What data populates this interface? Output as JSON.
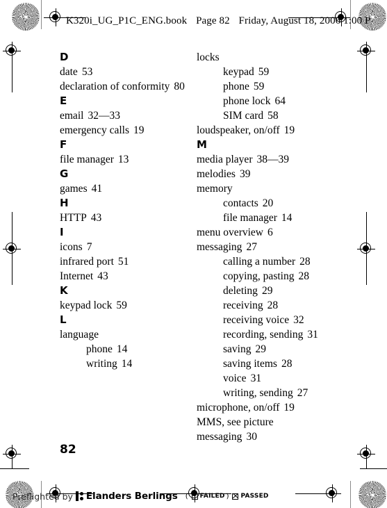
{
  "header": {
    "filename": "K320i_UG_P1C_ENG.book",
    "page_label": "Page 82",
    "timestamp": "Friday, August 18, 2006 1:00 P"
  },
  "folio": "82",
  "index": {
    "left_column": [
      {
        "letter": "D",
        "entries": [
          {
            "label": "date",
            "page": "53",
            "sub": false
          },
          {
            "label": "declaration of conformity",
            "page": "80",
            "sub": false
          }
        ]
      },
      {
        "letter": "E",
        "entries": [
          {
            "label": "email",
            "page": "32—33",
            "sub": false
          },
          {
            "label": "emergency calls",
            "page": "19",
            "sub": false
          }
        ]
      },
      {
        "letter": "F",
        "entries": [
          {
            "label": "file manager",
            "page": "13",
            "sub": false
          }
        ]
      },
      {
        "letter": "G",
        "entries": [
          {
            "label": "games",
            "page": "41",
            "sub": false
          }
        ]
      },
      {
        "letter": "H",
        "entries": [
          {
            "label": "HTTP",
            "page": "43",
            "sub": false
          }
        ]
      },
      {
        "letter": "I",
        "entries": [
          {
            "label": "icons",
            "page": "7",
            "sub": false
          },
          {
            "label": "infrared port",
            "page": "51",
            "sub": false
          },
          {
            "label": "Internet",
            "page": "43",
            "sub": false
          }
        ]
      },
      {
        "letter": "K",
        "entries": [
          {
            "label": "keypad lock",
            "page": "59",
            "sub": false
          }
        ]
      },
      {
        "letter": "L",
        "entries": [
          {
            "label": "language",
            "page": "",
            "sub": false
          },
          {
            "label": "phone",
            "page": "14",
            "sub": true
          },
          {
            "label": "writing",
            "page": "14",
            "sub": true
          }
        ]
      }
    ],
    "right_column": [
      {
        "letter": "",
        "entries": [
          {
            "label": "locks",
            "page": "",
            "sub": false
          },
          {
            "label": "keypad",
            "page": "59",
            "sub": true
          },
          {
            "label": "phone",
            "page": "59",
            "sub": true
          },
          {
            "label": "phone lock",
            "page": "64",
            "sub": true
          },
          {
            "label": "SIM card",
            "page": "58",
            "sub": true
          },
          {
            "label": "loudspeaker, on/off",
            "page": "19",
            "sub": false
          }
        ]
      },
      {
        "letter": "M",
        "entries": [
          {
            "label": "media player",
            "page": "38—39",
            "sub": false
          },
          {
            "label": "melodies",
            "page": "39",
            "sub": false
          },
          {
            "label": "memory",
            "page": "",
            "sub": false
          },
          {
            "label": "contacts",
            "page": "20",
            "sub": true
          },
          {
            "label": "file manager",
            "page": "14",
            "sub": true
          },
          {
            "label": "menu overview",
            "page": "6",
            "sub": false
          },
          {
            "label": "messaging",
            "page": "27",
            "sub": false
          },
          {
            "label": "calling a number",
            "page": "28",
            "sub": true
          },
          {
            "label": "copying, pasting",
            "page": "28",
            "sub": true
          },
          {
            "label": "deleting",
            "page": "29",
            "sub": true
          },
          {
            "label": "receiving",
            "page": "28",
            "sub": true
          },
          {
            "label": "receiving voice",
            "page": "32",
            "sub": true
          },
          {
            "label": "recording, sending",
            "page": "31",
            "sub": true
          },
          {
            "label": "saving",
            "page": "29",
            "sub": true
          },
          {
            "label": "saving items",
            "page": "28",
            "sub": true
          },
          {
            "label": "voice",
            "page": "31",
            "sub": true
          },
          {
            "label": "writing, sending",
            "page": "27",
            "sub": true
          },
          {
            "label": "microphone, on/off",
            "page": "19",
            "sub": false
          },
          {
            "label": "MMS, see picture",
            "page": "",
            "sub": false
          },
          {
            "label": "messaging",
            "page": "30",
            "sub": false
          }
        ]
      }
    ]
  },
  "preflight": {
    "by_text": "Preflighted by",
    "company": "Elanders Berlings",
    "open_paren": "(",
    "failed_label": "FAILED",
    "close_paren": ")",
    "passed_label": "PASSED"
  }
}
